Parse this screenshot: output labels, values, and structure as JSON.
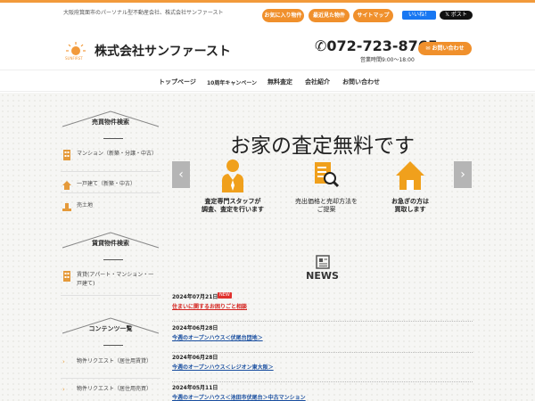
{
  "header": {
    "tagline": "大阪府箕面市のパーソナル型不動産会社、株式会社サンファースト",
    "quick_links": [
      "お気に入り物件",
      "最近見た物件",
      "サイトマップ"
    ],
    "fb_like": "いいね！",
    "x_post": "ポスト",
    "logo_text": "SUNFIRST",
    "company_name": "株式会社サンファースト",
    "phone": "072-723-8765",
    "hours": "営業時間9:00～18:00",
    "contact_button": "お問い合わせ"
  },
  "nav": {
    "items": [
      "トップページ",
      "10周年キャンペーン",
      "無料査定",
      "会社紹介",
      "お問い合わせ"
    ]
  },
  "sidebar": {
    "sections": [
      {
        "title": "売買物件検索",
        "items": [
          "マンション（新築・分譲・中古）",
          "一戸建て（新築・中古）",
          "売土地"
        ]
      },
      {
        "title": "賃貸物件検索",
        "items": [
          "賃貸(アパート・マンション・一戸建て)"
        ]
      },
      {
        "title": "コンテンツ一覧",
        "items": [
          "物件リクエスト（居住用賃貸）",
          "物件リクエスト（居住用売買）"
        ]
      }
    ]
  },
  "hero": {
    "title": "お家の査定無料です",
    "prev": "‹",
    "next": "›",
    "features": [
      {
        "icon": "staff-icon",
        "lines": [
          "査定専門スタッフが",
          "調査、査定を行います"
        ],
        "bold": true
      },
      {
        "icon": "document-search-icon",
        "lines": [
          "売出価格と売却方法を",
          "ご提案"
        ],
        "bold": false
      },
      {
        "icon": "house-icon",
        "lines": [
          "お急ぎの方は",
          "買取します"
        ],
        "bold": true
      }
    ]
  },
  "news": {
    "title": "NEWS",
    "items": [
      {
        "date": "2024年07月21日",
        "badge": "NEW",
        "text": "住まいに関するお困りごと相談",
        "red": true
      },
      {
        "date": "2024年06月28日",
        "badge": "",
        "text": "今週のオープンハウス＜伏尾台団地＞",
        "red": false
      },
      {
        "date": "2024年06月28日",
        "badge": "",
        "text": "今週のオープンハウス＜レジオン東大阪＞",
        "red": false
      },
      {
        "date": "2024年05月11日",
        "badge": "",
        "text": "今週のオープンハウス＜池田市伏尾台＞中古マンション",
        "red": false
      }
    ]
  },
  "colors": {
    "accent": "#f0902c",
    "link": "#1a4fa0",
    "new_badge": "#e0312d"
  }
}
